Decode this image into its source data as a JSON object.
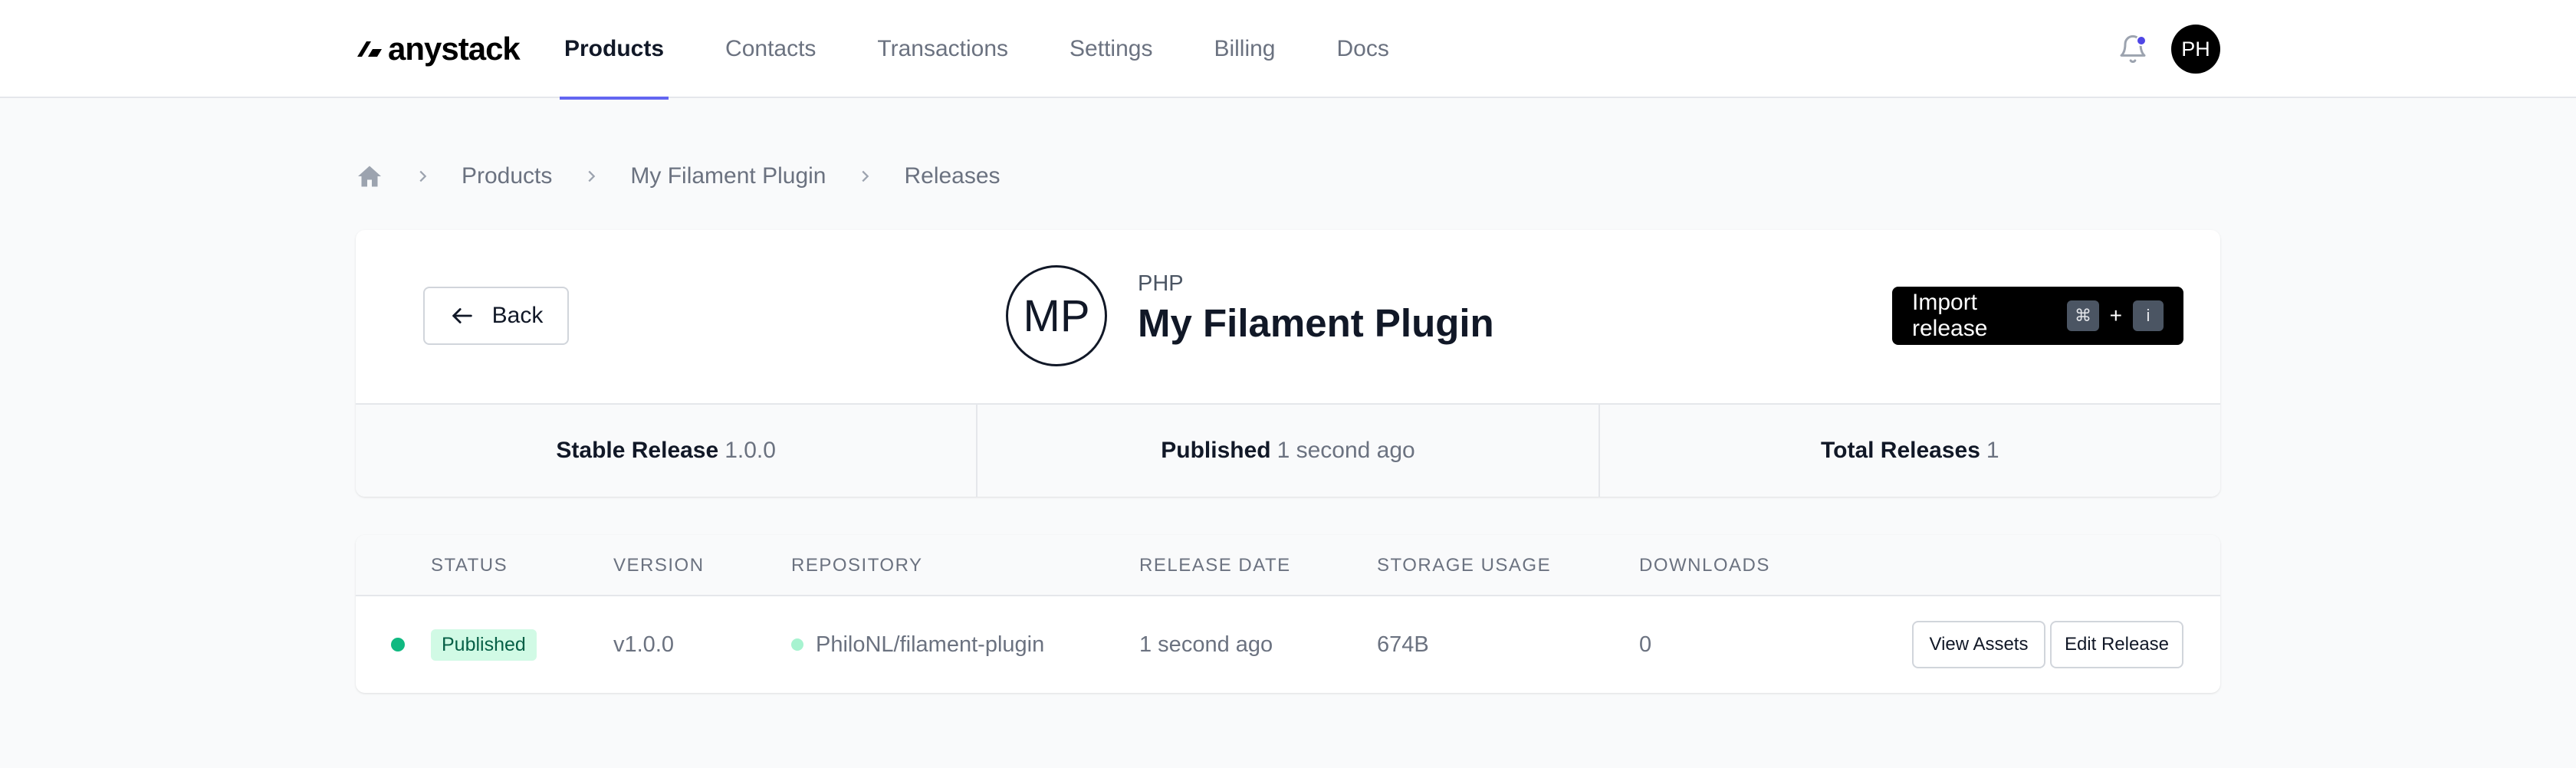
{
  "brand": {
    "name": "anystack"
  },
  "nav": {
    "items": [
      {
        "label": "Products",
        "active": true
      },
      {
        "label": "Contacts",
        "active": false
      },
      {
        "label": "Transactions",
        "active": false
      },
      {
        "label": "Settings",
        "active": false
      },
      {
        "label": "Billing",
        "active": false
      },
      {
        "label": "Docs",
        "active": false
      }
    ],
    "notification_unread": true,
    "avatar_initials": "PH"
  },
  "breadcrumb": {
    "home_icon": "home-icon",
    "items": [
      "Products",
      "My Filament Plugin",
      "Releases"
    ]
  },
  "product": {
    "back_label": "Back",
    "avatar_initials": "MP",
    "language": "PHP",
    "name": "My Filament Plugin",
    "import_label": "Import release",
    "shortcut": {
      "key1": "⌘",
      "plus": "+",
      "key2": "i"
    }
  },
  "stats": [
    {
      "label": "Stable Release",
      "value": "1.0.0"
    },
    {
      "label": "Published",
      "value": "1 second ago"
    },
    {
      "label": "Total Releases",
      "value": "1"
    }
  ],
  "releases": {
    "columns": [
      "STATUS",
      "VERSION",
      "REPOSITORY",
      "RELEASE DATE",
      "STORAGE USAGE",
      "DOWNLOADS"
    ],
    "rows": [
      {
        "status": "Published",
        "version": "v1.0.0",
        "repository": "PhiloNL/filament-plugin",
        "release_date": "1 second ago",
        "storage": "674B",
        "downloads": "0",
        "view_label": "View Assets",
        "edit_label": "Edit Release"
      }
    ]
  },
  "colors": {
    "accent": "#6366f1",
    "status_green": "#10b981",
    "badge_bg": "#d1fae5",
    "badge_text": "#065f46"
  }
}
